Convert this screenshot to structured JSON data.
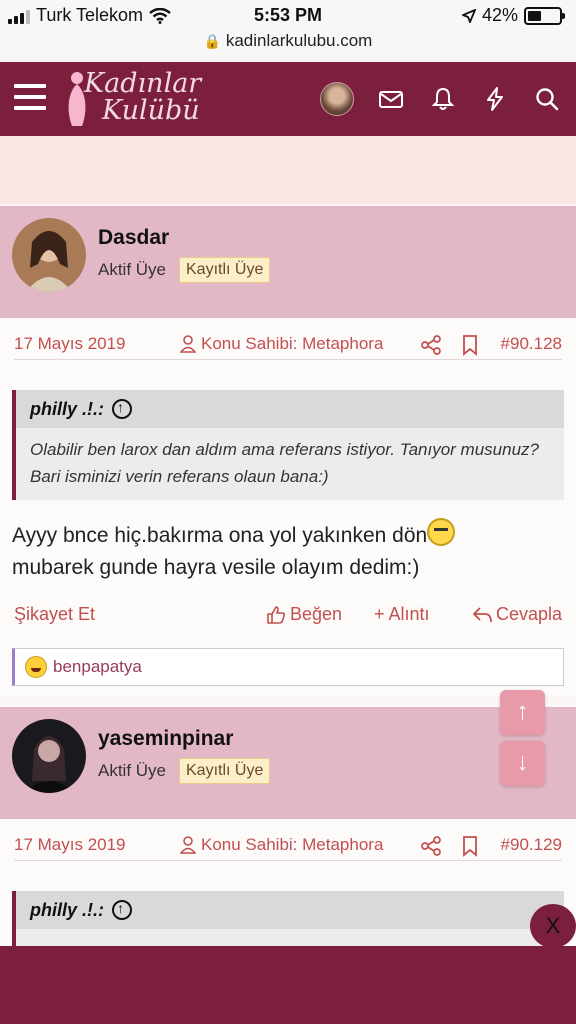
{
  "status_bar": {
    "carrier": "Turk Telekom",
    "time": "5:53 PM",
    "battery": "42%",
    "battery_level": 0.42,
    "url": "kadinlarkulubu.com",
    "icons": [
      "signal-icon",
      "wifi-icon",
      "location-icon",
      "battery-icon",
      "lock-icon"
    ]
  },
  "header": {
    "logo_line1": "Kadınlar",
    "logo_line2": "Kulübü",
    "icons": [
      "menu-icon",
      "avatar",
      "mail-icon",
      "bell-icon",
      "bolt-icon",
      "search-icon"
    ]
  },
  "colors": {
    "brand": "#7b1f3c",
    "post_header": "#e3b8c6",
    "accent_text": "#c2504f",
    "badge_bg": "#fbeec9"
  },
  "posts": [
    {
      "username": "Dasdar",
      "rank": "Aktif Üye",
      "badge": "Kayıtlı Üye",
      "date": "17 Mayıs 2019",
      "owner": "Konu Sahibi: Metaphora",
      "post_number": "#90.128",
      "quote_author": "philly .!.:",
      "quote_text": "Olabilir ben larox dan aldım ama referans istiyor. Tanıyor musunuz? Bari isminizi verin referans olaun bana:)",
      "message_part1": "Ayyy bnce hiç.bakırma ona yol yakınken dön",
      "message_part2": "mubarek gunde hayra vesile olayım dedim:)",
      "report": "Şikayet Et",
      "like": "Beğen",
      "quote_action": "+ Alıntı",
      "reply": "Cevapla",
      "reaction_user": "benpapatya"
    },
    {
      "username": "yaseminpinar",
      "rank": "Aktif Üye",
      "badge": "Kayıtlı Üye",
      "date": "17 Mayıs 2019",
      "owner": "Konu Sahibi: Metaphora",
      "post_number": "#90.129",
      "quote_author": "philly .!.:"
    }
  ],
  "scroll": {
    "up": "↑",
    "down": "↓"
  },
  "close_label": "X"
}
